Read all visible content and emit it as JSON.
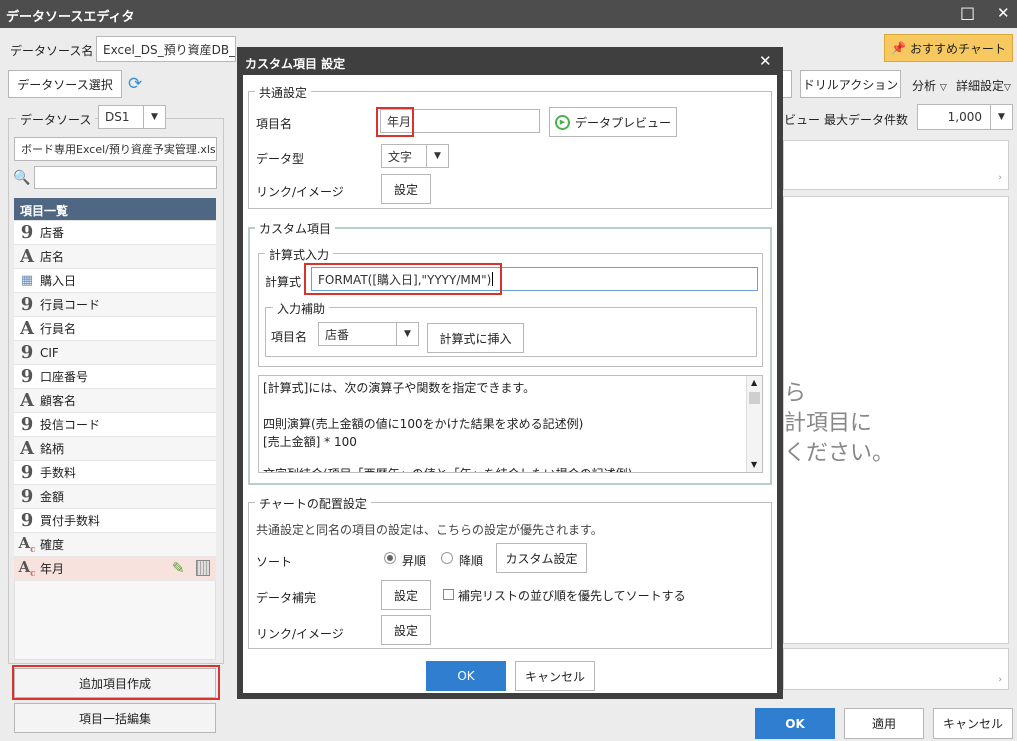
{
  "window": {
    "title": "データソースエディタ",
    "minimize_icon": "□",
    "close_icon": "✕"
  },
  "top": {
    "datasource_name_label": "データソース名",
    "datasource_name_value": "Excel_DS_預り資産DB_MPView用",
    "recommend_chart": "おすすめチャート",
    "datasource_select": "データソース選択",
    "drill_action": "ドリルアクション",
    "analysis": "分析",
    "detail_settings": "詳細設定",
    "preview_label": "ビュー",
    "max_rows_label": "最大データ件数",
    "max_rows_value": "1,000"
  },
  "left": {
    "datasource_label": "データソース",
    "ds_value": "DS1",
    "file_path": "ボード専用Excel/預り資産予実管理.xlsx",
    "search_placeholder": "",
    "list_header": "項目一覧",
    "items": [
      {
        "icon": "9",
        "label": "店番"
      },
      {
        "icon": "A",
        "label": "店名"
      },
      {
        "icon": "cal",
        "label": "購入日"
      },
      {
        "icon": "9",
        "label": "行員コード"
      },
      {
        "icon": "A",
        "label": "行員名"
      },
      {
        "icon": "9",
        "label": "CIF"
      },
      {
        "icon": "9",
        "label": "口座番号"
      },
      {
        "icon": "A",
        "label": "顧客名"
      },
      {
        "icon": "9",
        "label": "投信コード"
      },
      {
        "icon": "A",
        "label": "銘柄"
      },
      {
        "icon": "9",
        "label": "手数料"
      },
      {
        "icon": "9",
        "label": "金額"
      },
      {
        "icon": "9",
        "label": "買付手数料"
      },
      {
        "icon": "Ac",
        "label": "確度"
      },
      {
        "icon": "Ac",
        "label": "年月"
      }
    ],
    "add_item_button": "追加項目作成",
    "bulk_edit_button": "項目一括編集"
  },
  "background_text": {
    "line1": "ら",
    "line2": "計項目に",
    "line3": "ください。"
  },
  "footer": {
    "ok": "OK",
    "apply": "適用",
    "cancel": "キャンセル"
  },
  "dialog": {
    "title": "カスタム項目 設定",
    "close_icon": "✕",
    "common": {
      "title": "共通設定",
      "item_name_label": "項目名",
      "item_name_value": "年月",
      "data_preview": "データプレビュー",
      "data_type_label": "データ型",
      "data_type_value": "文字",
      "link_label": "リンク/イメージ",
      "settings": "設定"
    },
    "custom": {
      "title": "カスタム項目",
      "formula_group": "計算式入力",
      "formula_label": "計算式",
      "formula_value": "FORMAT([購入日],\"YYYY/MM\")",
      "assist_group": "入力補助",
      "assist_item_label": "項目名",
      "assist_item_value": "店番",
      "insert_button": "計算式に挿入",
      "help_lines": [
        "[計算式]には、次の演算子や関数を指定できます。",
        "",
        "四則演算(売上金額の値に100をかけた結果を求める記述例)",
        "[売上金額] * 100",
        "",
        "文字列結合(項目「西暦年」の値と「年」を結合したい場合の記述例)"
      ]
    },
    "chart": {
      "title": "チャートの配置設定",
      "note": "共通設定と同名の項目の設定は、こちらの設定が優先されます。",
      "sort_label": "ソート",
      "asc": "昇順",
      "desc": "降順",
      "custom_settings": "カスタム設定",
      "complement_label": "データ補完",
      "settings": "設定",
      "complement_checkbox": "補完リストの並び順を優先してソートする",
      "link_label": "リンク/イメージ"
    },
    "ok": "OK",
    "cancel": "キャンセル"
  }
}
